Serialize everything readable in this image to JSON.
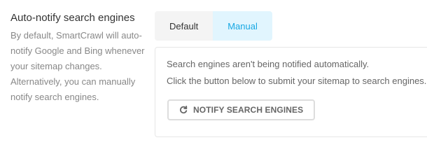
{
  "setting": {
    "title": "Auto-notify search engines",
    "description": "By default, SmartCrawl will auto-notify Google and Bing whenever your sitemap changes. Alternatively, you can manually notify search engines."
  },
  "tabs": [
    {
      "label": "Default",
      "active": false
    },
    {
      "label": "Manual",
      "active": true
    }
  ],
  "panel": {
    "line1": "Search engines aren't being notified automatically.",
    "line2": "Click the button below to submit your sitemap to search engines.",
    "button_label": "NOTIFY SEARCH ENGINES",
    "button_icon": "refresh-icon"
  },
  "colors": {
    "accent": "#17a8e3",
    "active_tab_bg": "#e1f5fe",
    "inactive_tab_bg": "#f4f4f4"
  }
}
